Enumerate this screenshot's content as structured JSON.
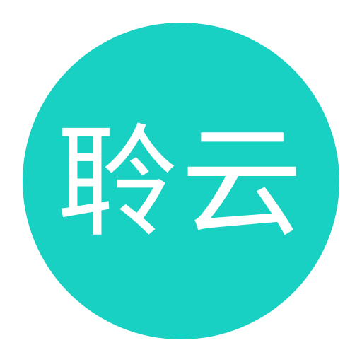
{
  "logo": {
    "text": "聆云",
    "background_color": "#19d1c2",
    "text_color": "#ffffff"
  }
}
